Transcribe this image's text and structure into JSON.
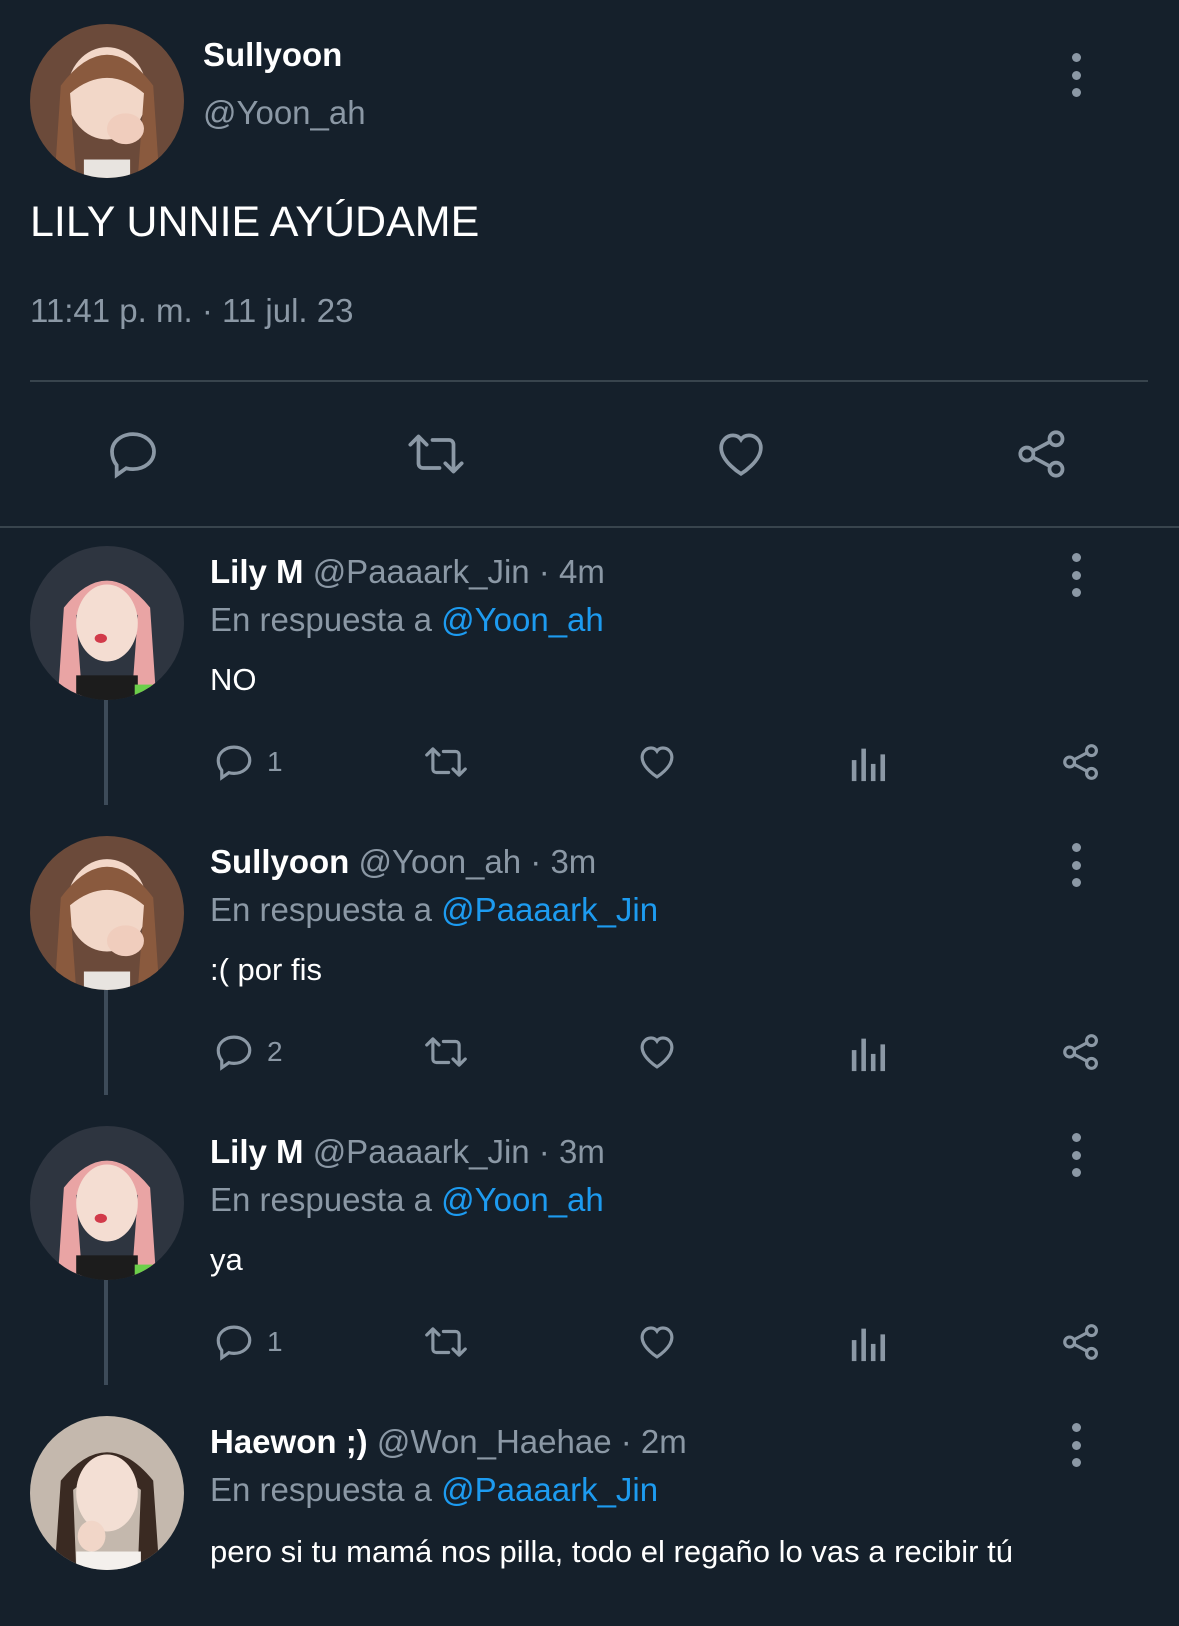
{
  "main_tweet": {
    "name": "Sullyoon",
    "handle": "@Yoon_ah",
    "text": "LILY UNNIE AYÚDAME",
    "timestamp": "11:41 p. m. · 11 jul. 23"
  },
  "replies": [
    {
      "name": "Lily M",
      "meta": "@Paaaark_Jin · 4m",
      "reply_prefix": "En respuesta a",
      "reply_to": "@Yoon_ah",
      "text": "NO",
      "reply_count": "1"
    },
    {
      "name": "Sullyoon",
      "meta": "@Yoon_ah · 3m",
      "reply_prefix": "En respuesta a",
      "reply_to": "@Paaaark_Jin",
      "text": ":( por fis",
      "reply_count": "2"
    },
    {
      "name": "Lily M",
      "meta": "@Paaaark_Jin · 3m",
      "reply_prefix": "En respuesta a",
      "reply_to": "@Yoon_ah",
      "text": "ya",
      "reply_count": "1"
    },
    {
      "name": "Haewon ;)",
      "meta": "@Won_Haehae · 2m",
      "reply_prefix": "En respuesta a",
      "reply_to": "@Paaaark_Jin",
      "text": "pero si tu mamá nos pilla, todo el regaño lo vas a recibir tú",
      "reply_count": ""
    }
  ],
  "colors": {
    "background": "#15202b",
    "muted": "#8b98a5",
    "link": "#1d9bf0",
    "divider": "#38444d"
  },
  "icons": [
    "more-options-icon",
    "reply-icon",
    "retweet-icon",
    "like-icon",
    "share-icon",
    "views-icon"
  ]
}
